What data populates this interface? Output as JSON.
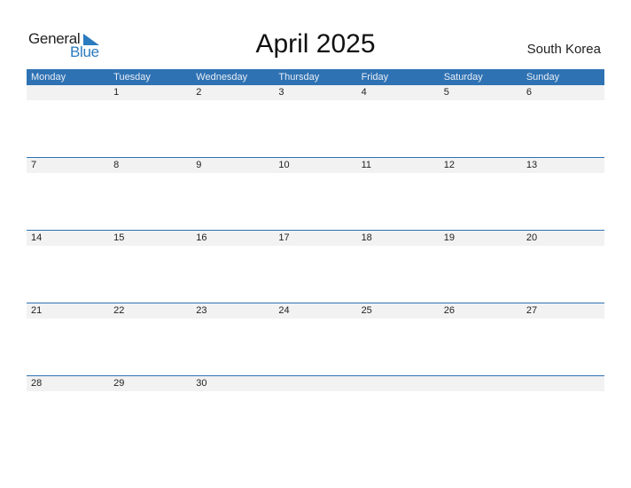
{
  "logo": {
    "line1": "General",
    "line2": "Blue",
    "icon": "blue-triangle-icon",
    "accent": "#2b7bbf"
  },
  "header": {
    "title": "April 2025",
    "country": "South Korea"
  },
  "colors": {
    "header_bar": "#2e72b3",
    "day_strip": "#f2f2f2"
  },
  "calendar": {
    "days": [
      "Monday",
      "Tuesday",
      "Wednesday",
      "Thursday",
      "Friday",
      "Saturday",
      "Sunday"
    ],
    "weeks": [
      [
        "",
        "1",
        "2",
        "3",
        "4",
        "5",
        "6"
      ],
      [
        "7",
        "8",
        "9",
        "10",
        "11",
        "12",
        "13"
      ],
      [
        "14",
        "15",
        "16",
        "17",
        "18",
        "19",
        "20"
      ],
      [
        "21",
        "22",
        "23",
        "24",
        "25",
        "26",
        "27"
      ],
      [
        "28",
        "29",
        "30",
        "",
        "",
        "",
        ""
      ]
    ]
  }
}
